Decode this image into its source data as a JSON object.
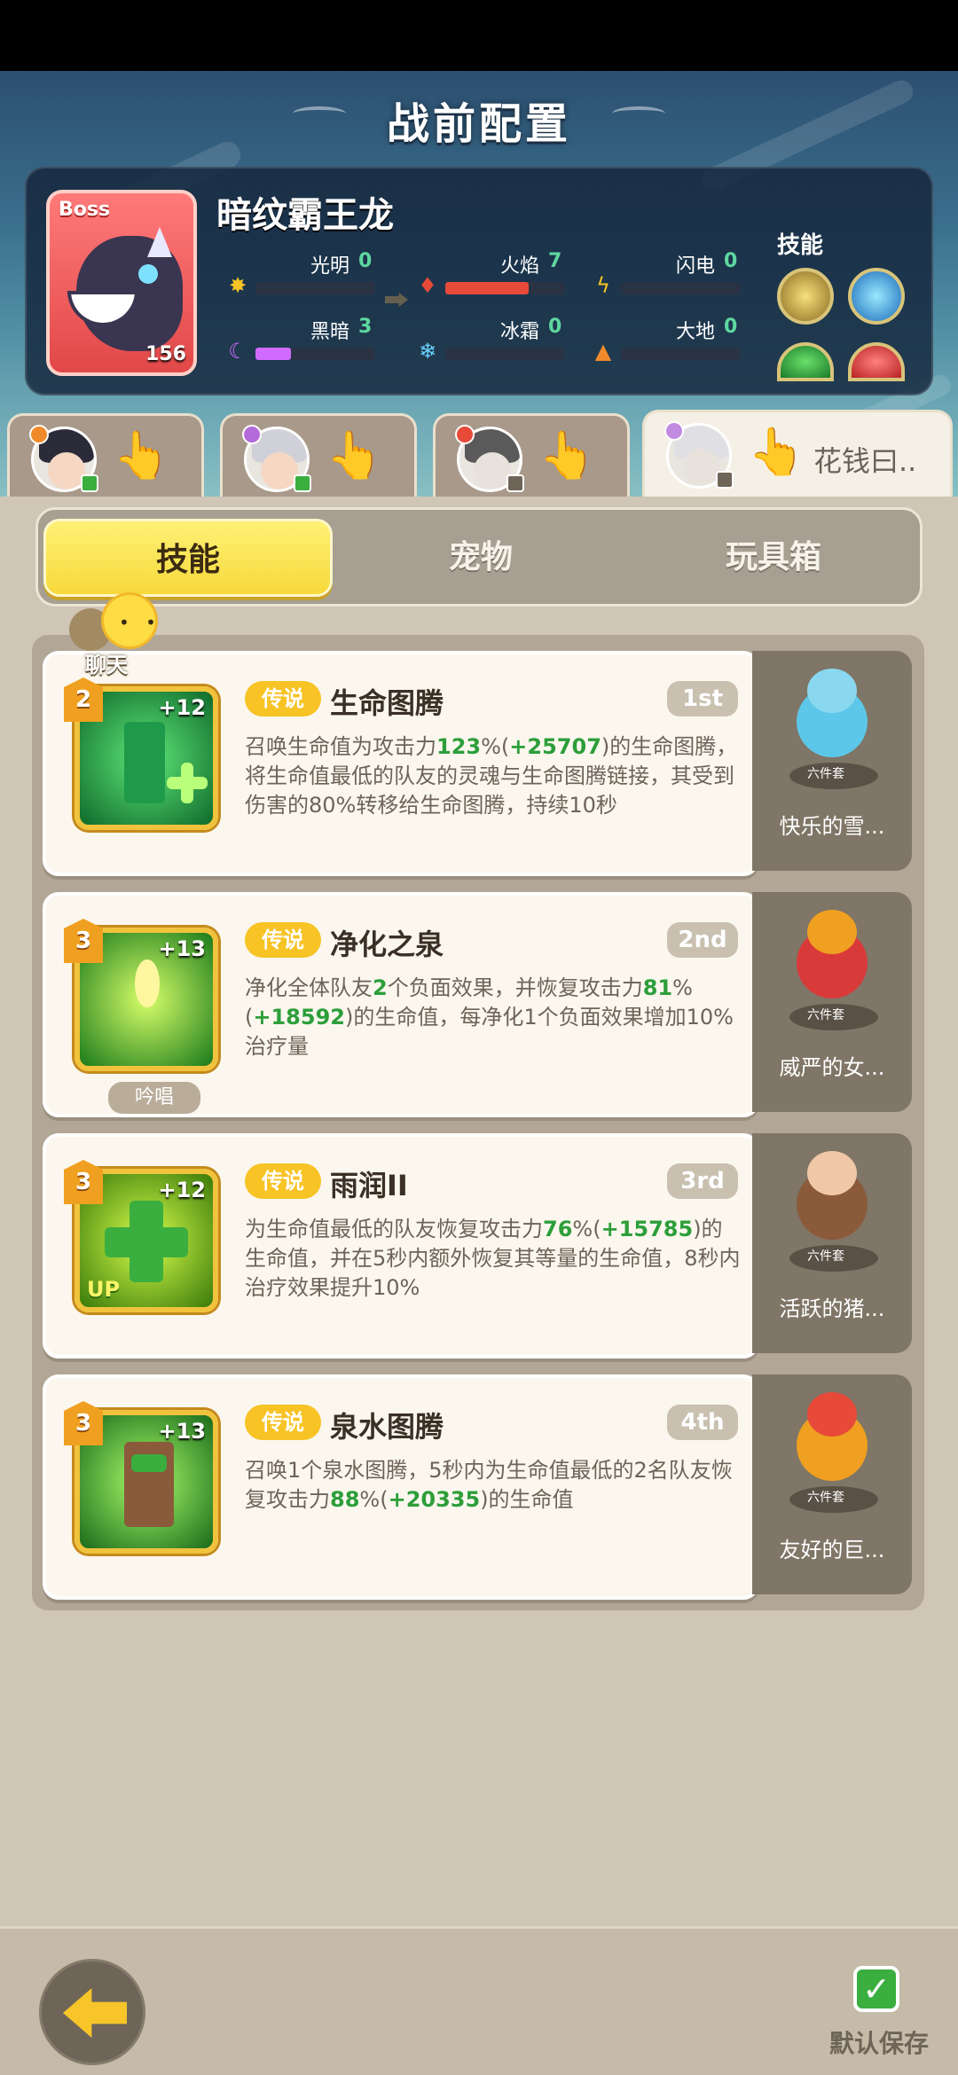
{
  "page_title": "战前配置",
  "boss": {
    "tag": "Boss",
    "name": "暗纹霸王龙",
    "level": "156",
    "elements": [
      {
        "label": "光明",
        "value": "0",
        "icon": "sun-icon",
        "color": "#f7c325",
        "fill": 0.0
      },
      {
        "label": "火焰",
        "value": "7",
        "icon": "flame-icon",
        "color": "#e84a3a",
        "fill": 0.7
      },
      {
        "label": "闪电",
        "value": "0",
        "icon": "lightning-icon",
        "color": "#f7c325",
        "fill": 0.0
      },
      {
        "label": "黑暗",
        "value": "3",
        "icon": "moon-icon",
        "color": "#d06bff",
        "fill": 0.3
      },
      {
        "label": "冰霜",
        "value": "0",
        "icon": "snowflake-icon",
        "color": "#6ad3ff",
        "fill": 0.0
      },
      {
        "label": "大地",
        "value": "0",
        "icon": "mountain-icon",
        "color": "#f08a2a",
        "fill": 0.0
      }
    ],
    "skills_label": "技能"
  },
  "characters": [
    {
      "name": "",
      "active": false
    },
    {
      "name": "",
      "active": false
    },
    {
      "name": "",
      "active": false
    },
    {
      "name": "花钱曰..",
      "active": true
    }
  ],
  "tabs": [
    {
      "label": "技能",
      "active": true
    },
    {
      "label": "宠物",
      "active": false
    },
    {
      "label": "玩具箱",
      "active": false
    }
  ],
  "chat": {
    "label": "聊天"
  },
  "skills": [
    {
      "level": "2",
      "plus": "+12",
      "rarity": "传说",
      "name": "生命图腾",
      "rank": "1st",
      "desc": [
        {
          "t": "召唤生命值为攻击力"
        },
        {
          "t": "123",
          "hl": true
        },
        {
          "t": "%("
        },
        {
          "t": "+25707",
          "hl": true
        },
        {
          "t": ")的生命图腾，将生命值最低的队友的灵魂与生命图腾链接，其受到伤害的80%转移给生命图腾，持续10秒"
        }
      ],
      "chant": "",
      "pet": {
        "name": "快乐的雪...",
        "set": "六件套"
      }
    },
    {
      "level": "3",
      "plus": "+13",
      "rarity": "传说",
      "name": "净化之泉",
      "rank": "2nd",
      "desc": [
        {
          "t": "净化全体队友"
        },
        {
          "t": "2",
          "hl": true
        },
        {
          "t": "个负面效果，并恢复攻击力"
        },
        {
          "t": "81",
          "hl": true
        },
        {
          "t": "%("
        },
        {
          "t": "+18592",
          "hl": true
        },
        {
          "t": ")的生命值，每净化1个负面效果增加10%治疗量"
        }
      ],
      "chant": "吟唱",
      "pet": {
        "name": "威严的女...",
        "set": "六件套"
      }
    },
    {
      "level": "3",
      "plus": "+12",
      "rarity": "传说",
      "name": "雨润II",
      "rank": "3rd",
      "desc": [
        {
          "t": "为生命值最低的队友恢复攻击力"
        },
        {
          "t": "76",
          "hl": true
        },
        {
          "t": "%("
        },
        {
          "t": "+15785",
          "hl": true
        },
        {
          "t": ")的生命值，并在5秒内额外恢复其等量的生命值，8秒内治疗效果提升10%"
        }
      ],
      "chant": "",
      "up_label": "UP",
      "pet": {
        "name": "活跃的猪...",
        "set": "六件套"
      }
    },
    {
      "level": "3",
      "plus": "+13",
      "rarity": "传说",
      "name": "泉水图腾",
      "rank": "4th",
      "desc": [
        {
          "t": "召唤1个泉水图腾，5秒内为生命值最低的2名队友恢复攻击力"
        },
        {
          "t": "88",
          "hl": true
        },
        {
          "t": "%("
        },
        {
          "t": "+20335",
          "hl": true
        },
        {
          "t": ")的生命值"
        }
      ],
      "chant": "",
      "pet": {
        "name": "友好的巨...",
        "set": "六件套"
      }
    }
  ],
  "footer": {
    "default_save_label": "默认保存",
    "checkmark": "✓"
  },
  "colors": {
    "accent_yellow": "#f7d93a",
    "highlight_green": "#2d9e3a",
    "legend_gold": "#f7c325"
  }
}
